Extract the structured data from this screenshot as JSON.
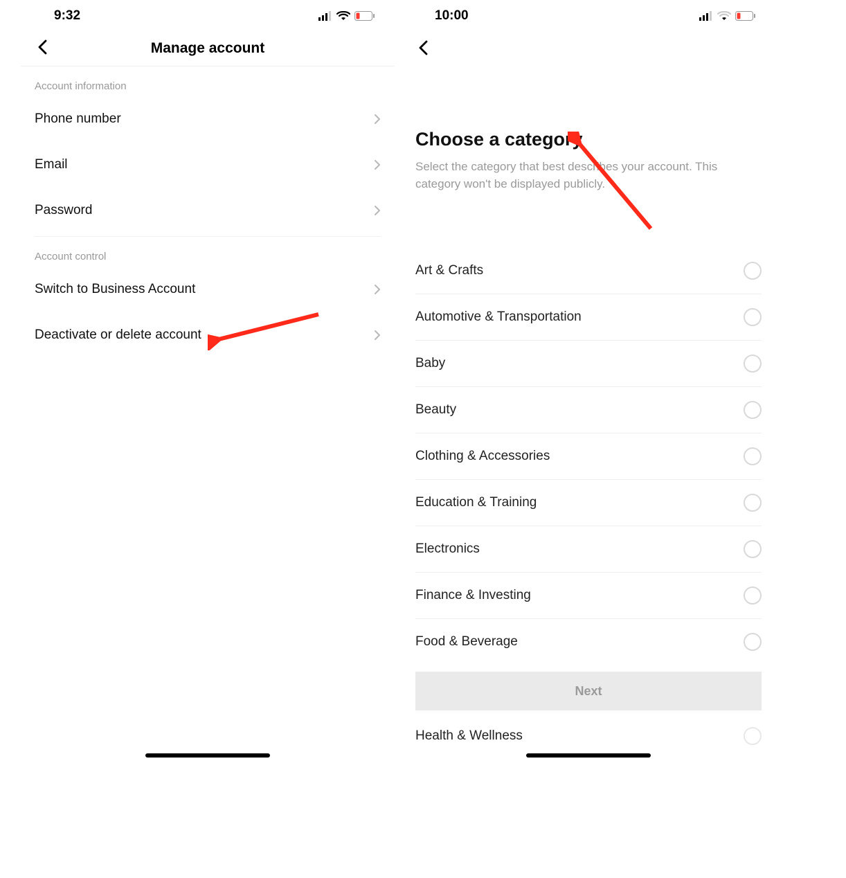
{
  "left": {
    "status_time": "9:32",
    "nav_title": "Manage account",
    "sections": [
      {
        "header": "Account information",
        "items": [
          {
            "label": "Phone number"
          },
          {
            "label": "Email"
          },
          {
            "label": "Password"
          }
        ]
      },
      {
        "header": "Account control",
        "items": [
          {
            "label": "Switch to Business Account"
          },
          {
            "label": "Deactivate or delete account"
          }
        ]
      }
    ]
  },
  "right": {
    "status_time": "10:00",
    "heading": "Choose a category",
    "subtext": "Select the category that best describes your account. This category won't be displayed publicly.",
    "categories": [
      "Art & Crafts",
      "Automotive & Transportation",
      "Baby",
      "Beauty",
      "Clothing & Accessories",
      "Education & Training",
      "Electronics",
      "Finance & Investing",
      "Food & Beverage"
    ],
    "next_label": "Next",
    "last_category": "Health & Wellness"
  }
}
